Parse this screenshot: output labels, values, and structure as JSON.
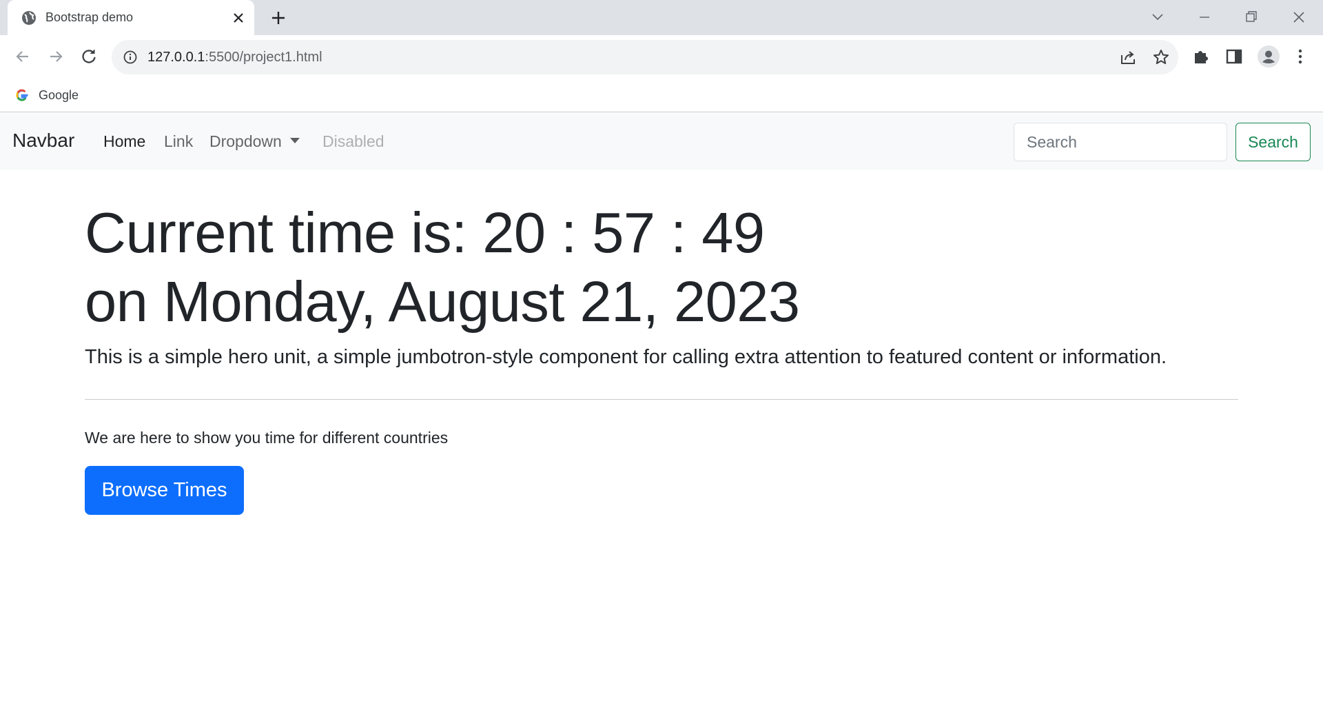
{
  "browser": {
    "tab_title": "Bootstrap demo",
    "url_host": "127.0.0.1",
    "url_path": ":5500/project1.html",
    "bookmark_google": "Google"
  },
  "navbar": {
    "brand": "Navbar",
    "links": [
      "Home",
      "Link",
      "Dropdown",
      "Disabled"
    ],
    "search_placeholder": "Search",
    "search_button": "Search"
  },
  "hero": {
    "time_line": "Current time is: 20 : 57 : 49",
    "date_line": "on Monday, August 21, 2023",
    "lead": "This is a simple hero unit, a simple jumbotron-style component for calling extra attention to featured content or information.",
    "para": "We are here to show you time for different countries",
    "button": "Browse Times"
  },
  "colors": {
    "primary": "#0d6efd",
    "success": "#198754",
    "navbar_bg": "#f8f9fa"
  },
  "icons": [
    "globe-icon",
    "close-icon",
    "plus-icon",
    "chevron-down-icon",
    "minimize-icon",
    "restore-icon",
    "window-close-icon",
    "back-icon",
    "forward-icon",
    "reload-icon",
    "info-icon",
    "share-icon",
    "star-icon",
    "extensions-icon",
    "side-panel-icon",
    "profile-icon",
    "menu-icon",
    "google-icon"
  ]
}
